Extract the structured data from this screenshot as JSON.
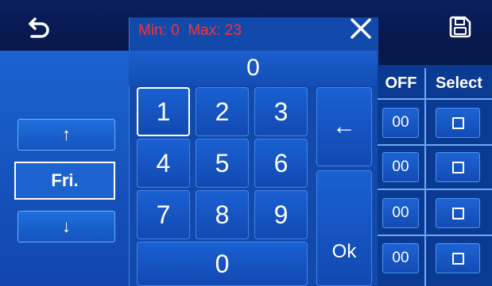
{
  "header": {
    "min_label": "Min: 0",
    "max_label": "Max: 23",
    "back_icon": "undo-arrow-icon",
    "close_icon": "close-icon",
    "save_icon": "floppy-disk-icon"
  },
  "left": {
    "up_symbol": "↑",
    "day_label": "Fri.",
    "down_symbol": "↓"
  },
  "keypad": {
    "display_value": "0",
    "keys": [
      "1",
      "2",
      "3",
      "4",
      "5",
      "6",
      "7",
      "8",
      "9",
      "0"
    ],
    "backspace_symbol": "←",
    "ok_label": "Ok"
  },
  "table": {
    "headers": [
      "OFF",
      "Select"
    ],
    "rows": [
      {
        "off": "00",
        "selected": false
      },
      {
        "off": "00",
        "selected": false
      },
      {
        "off": "00",
        "selected": false
      },
      {
        "off": "00",
        "selected": false
      }
    ]
  },
  "colors": {
    "min_max_text": "#ff3030",
    "panel_blue": "#1b63d0",
    "top_bar": "#0a1f5e"
  }
}
